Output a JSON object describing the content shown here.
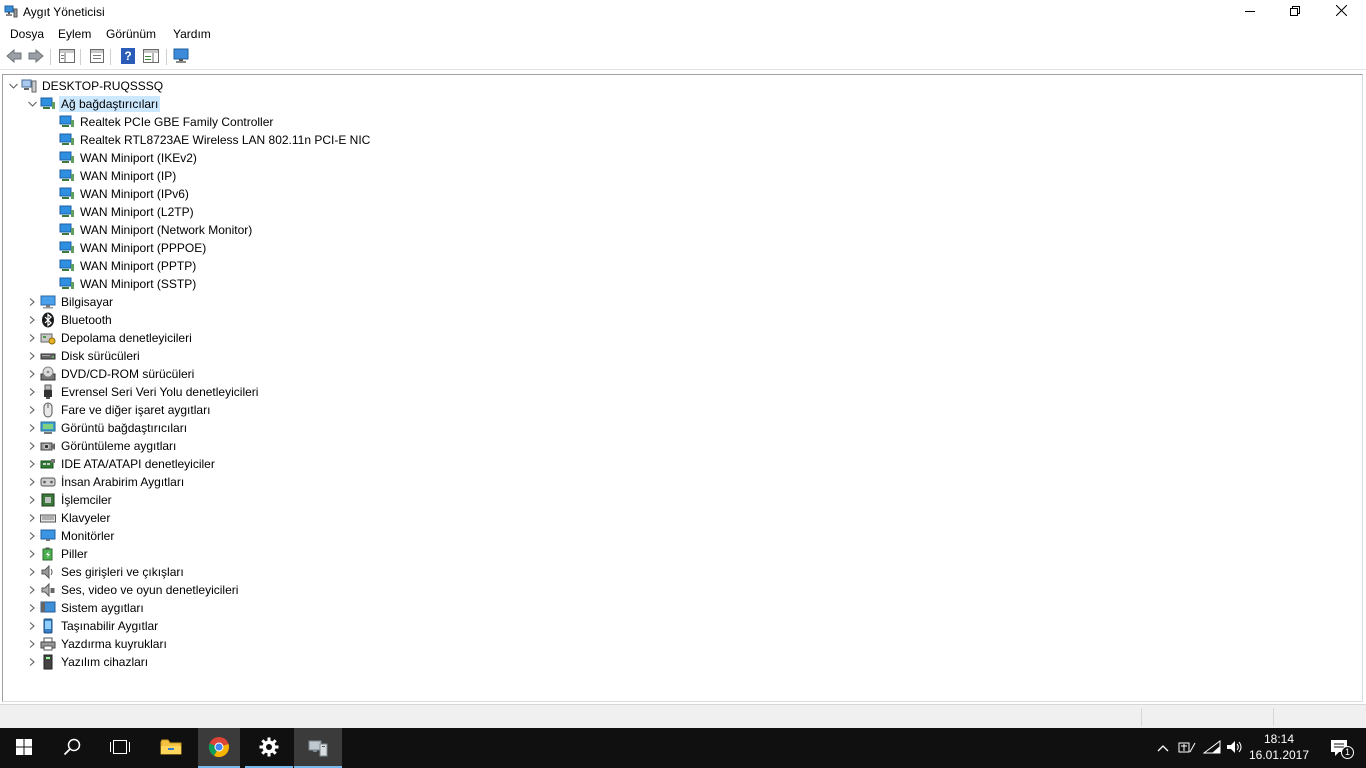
{
  "window": {
    "title": "Aygıt Yöneticisi",
    "icons": {
      "app": "device-manager-icon",
      "minimize": "minimize-icon",
      "maximize": "restore-icon",
      "close": "close-icon"
    }
  },
  "menu": {
    "items": [
      "Dosya",
      "Eylem",
      "Görünüm",
      "Yardım"
    ]
  },
  "toolbar": {
    "buttons": [
      "back-arrow-icon",
      "forward-arrow-icon",
      "show-hide-console-tree-icon",
      "properties-icon",
      "help-icon",
      "action-pane-icon",
      "scan-hardware-icon"
    ]
  },
  "tree": {
    "root": {
      "label": "DESKTOP-RUQSSSQ",
      "icon": "computer-icon"
    },
    "network": {
      "label": "Ağ bağdaştırıcıları",
      "icon": "network-adapter-icon",
      "children": [
        "Realtek PCIe GBE Family Controller",
        "Realtek RTL8723AE Wireless LAN 802.11n PCI-E NIC",
        "WAN Miniport (IKEv2)",
        "WAN Miniport (IP)",
        "WAN Miniport (IPv6)",
        "WAN Miniport (L2TP)",
        "WAN Miniport (Network Monitor)",
        "WAN Miniport (PPPOE)",
        "WAN Miniport (PPTP)",
        "WAN Miniport (SSTP)"
      ]
    },
    "categories": [
      {
        "label": "Bilgisayar",
        "icon": "computer-monitor-icon"
      },
      {
        "label": "Bluetooth",
        "icon": "bluetooth-icon"
      },
      {
        "label": "Depolama denetleyicileri",
        "icon": "storage-controller-icon"
      },
      {
        "label": "Disk sürücüleri",
        "icon": "disk-drive-icon"
      },
      {
        "label": "DVD/CD-ROM sürücüleri",
        "icon": "dvd-drive-icon"
      },
      {
        "label": "Evrensel Seri Veri Yolu denetleyicileri",
        "icon": "usb-icon"
      },
      {
        "label": "Fare ve diğer işaret aygıtları",
        "icon": "mouse-icon"
      },
      {
        "label": "Görüntü bağdaştırıcıları",
        "icon": "display-adapter-icon"
      },
      {
        "label": "Görüntüleme aygıtları",
        "icon": "camera-icon"
      },
      {
        "label": "IDE ATA/ATAPI denetleyiciler",
        "icon": "ide-controller-icon"
      },
      {
        "label": "İnsan Arabirim Aygıtları",
        "icon": "hid-icon"
      },
      {
        "label": "İşlemciler",
        "icon": "processor-icon"
      },
      {
        "label": "Klavyeler",
        "icon": "keyboard-icon"
      },
      {
        "label": "Monitörler",
        "icon": "monitor-icon"
      },
      {
        "label": "Piller",
        "icon": "battery-icon"
      },
      {
        "label": "Ses girişleri ve çıkışları",
        "icon": "speaker-icon"
      },
      {
        "label": "Ses, video ve oyun denetleyicileri",
        "icon": "sound-controller-icon"
      },
      {
        "label": "Sistem aygıtları",
        "icon": "system-device-icon"
      },
      {
        "label": "Taşınabilir Aygıtlar",
        "icon": "portable-device-icon"
      },
      {
        "label": "Yazdırma kuyrukları",
        "icon": "printer-icon"
      },
      {
        "label": "Yazılım cihazları",
        "icon": "software-device-icon"
      }
    ]
  },
  "taskbar": {
    "apps": [
      "start-icon",
      "search-icon",
      "task-view-icon",
      "file-explorer-icon",
      "chrome-icon",
      "settings-icon",
      "device-manager-icon"
    ],
    "tray": [
      "chevron-up-icon",
      "input-language-icon",
      "wifi-icon",
      "volume-icon"
    ],
    "time": "18:14",
    "date": "16.01.2017",
    "notifications": "1"
  },
  "colors": {
    "selection": "#cce8ff",
    "taskbar": "#101010",
    "taskbar_active": "#3b3b3b",
    "accent": "#76b9ed"
  }
}
